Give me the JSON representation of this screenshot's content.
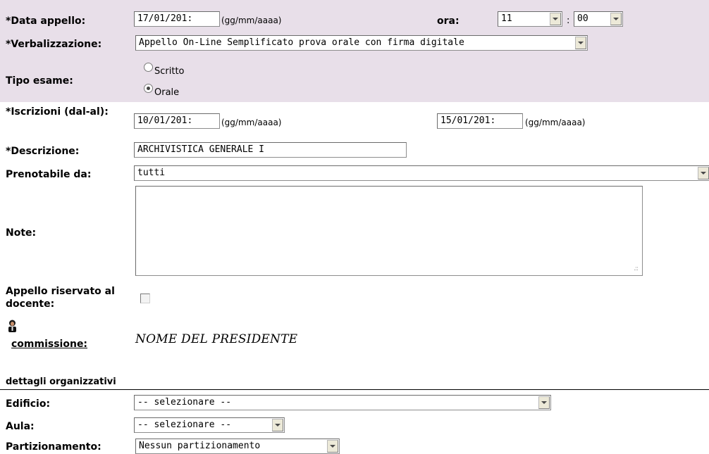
{
  "form": {
    "data_appello": {
      "label": "*Data appello:",
      "value": "17/01/201:",
      "hint": "(gg/mm/aaaa)"
    },
    "ora": {
      "label": "ora:",
      "hour": "11",
      "separator": ":",
      "minute": "00"
    },
    "verbalizzazione": {
      "label": "*Verbalizzazione:",
      "value": "Appello On-Line Semplificato prova orale con firma digitale"
    },
    "tipo_esame": {
      "label": "Tipo esame:",
      "options": [
        {
          "label": "Scritto",
          "checked": false
        },
        {
          "label": "Orale",
          "checked": true
        }
      ]
    },
    "iscrizioni": {
      "label": "*Iscrizioni (dal-al):",
      "from_value": "10/01/201:",
      "from_hint": "(gg/mm/aaaa)",
      "to_value": "15/01/201:",
      "to_hint": "(gg/mm/aaaa)"
    },
    "descrizione": {
      "label": "*Descrizione:",
      "value": "ARCHIVISTICA GENERALE I"
    },
    "prenotabile_da": {
      "label": "Prenotabile da:",
      "value": "tutti"
    },
    "note": {
      "label": "Note:",
      "value": ""
    },
    "appello_riservato": {
      "label": "Appello riservato al docente:",
      "checked": false
    },
    "commissione": {
      "link_label": "commissione:",
      "president": "NOME DEL PRESIDENTE",
      "icon": "person-icon"
    }
  },
  "dettagli": {
    "section_title": "dettagli organizzativi",
    "edificio": {
      "label": "Edificio:",
      "value": "-- selezionare --"
    },
    "aula": {
      "label": "Aula:",
      "value": "-- selezionare --"
    },
    "partizionamento": {
      "label": "Partizionamento:",
      "value": "Nessun partizionamento"
    }
  },
  "colors": {
    "header_band": "#e8dfe9",
    "divider": "#000000"
  }
}
